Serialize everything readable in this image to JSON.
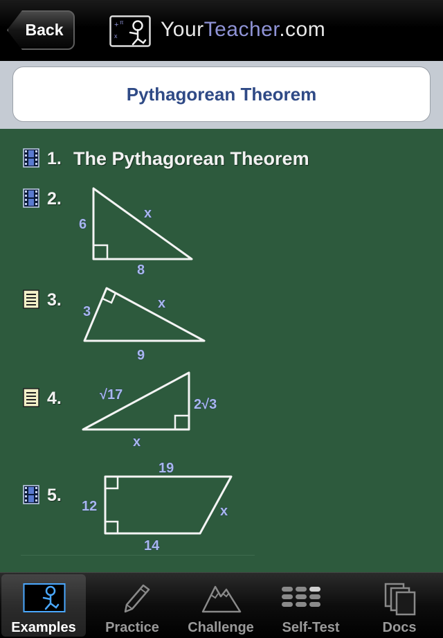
{
  "header": {
    "back_label": "Back",
    "brand_prefix": "Your",
    "brand_teacher": "Teacher",
    "brand_suffix": ".com"
  },
  "title": "Pythagorean Theorem",
  "examples": [
    {
      "number": "1.",
      "icon": "film-icon",
      "title": "The Pythagorean Theorem"
    },
    {
      "number": "2.",
      "icon": "film-icon",
      "labels": {
        "leg_vertical": "6",
        "hypotenuse": "x",
        "base": "8"
      }
    },
    {
      "number": "3.",
      "icon": "notes-icon",
      "labels": {
        "leg_left": "3",
        "hypotenuse": "x",
        "base": "9"
      }
    },
    {
      "number": "4.",
      "icon": "notes-icon",
      "labels": {
        "hypotenuse": "√17",
        "leg_vertical": "2√3",
        "base": "x"
      }
    },
    {
      "number": "5.",
      "icon": "film-icon",
      "labels": {
        "top": "19",
        "left": "12",
        "slant": "x",
        "bottom": "14"
      }
    }
  ],
  "tabs": [
    {
      "label": "Examples",
      "icon": "stick-figure-icon",
      "active": true
    },
    {
      "label": "Practice",
      "icon": "pencil-icon",
      "active": false
    },
    {
      "label": "Challenge",
      "icon": "mountain-icon",
      "active": false
    },
    {
      "label": "Self-Test",
      "icon": "keypad-icon",
      "active": false
    },
    {
      "label": "Docs",
      "icon": "documents-icon",
      "active": false
    }
  ],
  "colors": {
    "chalkboard": "#2d5a3d",
    "title_text": "#2f4a86",
    "label_blue": "#a9b8ee",
    "brand_teacher": "#8f93d6"
  }
}
